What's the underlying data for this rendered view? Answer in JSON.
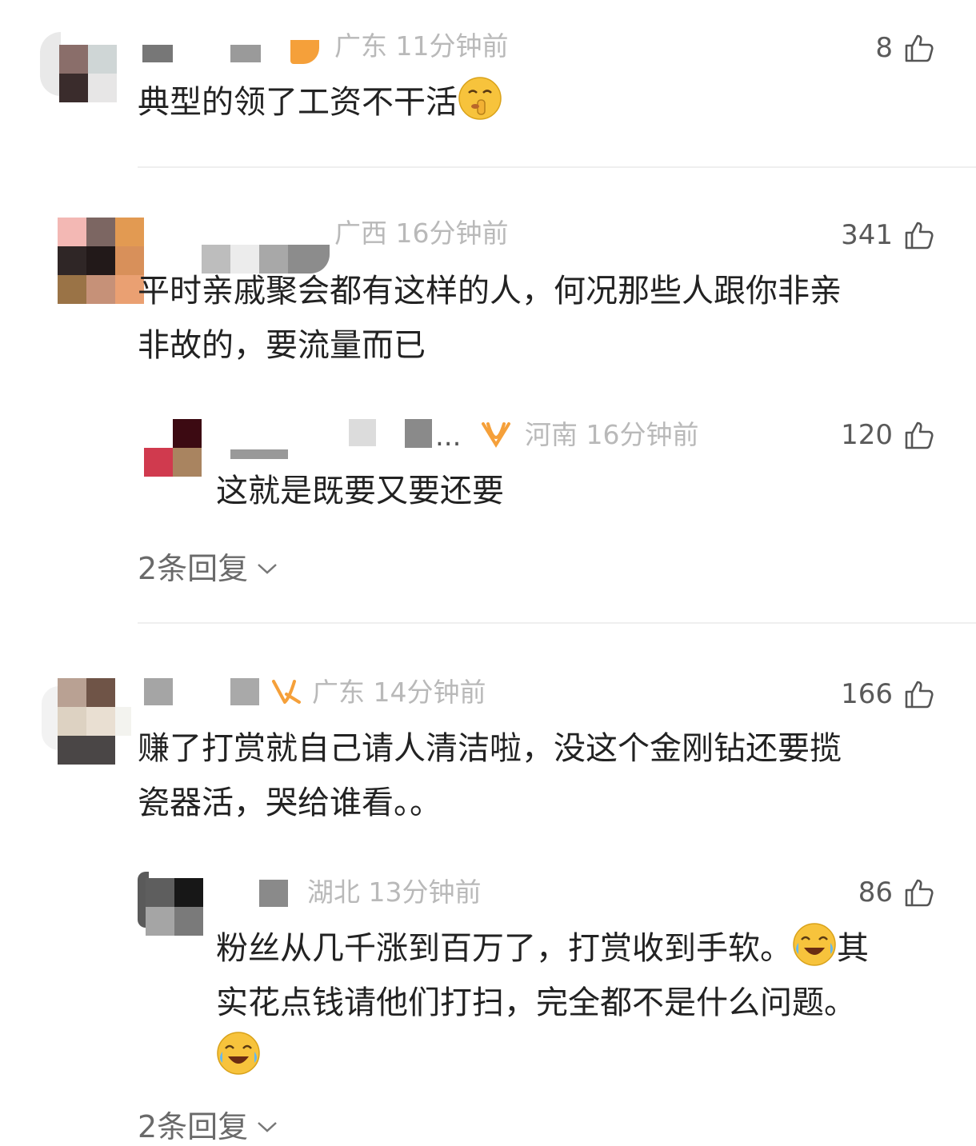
{
  "comments": [
    {
      "location_time": "广东 11分钟前",
      "likes": "8",
      "text": "典型的领了工资不干活",
      "emoji": "shush-emoji"
    },
    {
      "location_time": "广西 16分钟前",
      "likes": "341",
      "text_line1": "平时亲戚聚会都有这样的人，何况那些人跟你非亲",
      "text_line2": "非故的，要流量而已",
      "reply": {
        "ellipsis": "...",
        "location_time": "河南 16分钟前",
        "likes": "120",
        "text": "这就是既要又要还要"
      },
      "more_replies": "2条回复"
    },
    {
      "location_time": "广东 14分钟前",
      "likes": "166",
      "text_line1": "赚了打赏就自己请人清洁啦，没这个金刚钻还要揽",
      "text_line2": "瓷器活，哭给谁看。。",
      "reply": {
        "location_time": "湖北 13分钟前",
        "likes": "86",
        "text_line1a": "粉丝从几千涨到百万了，打赏收到手软。",
        "text_line1b": "其",
        "text_line2": "实花点钱请他们打扫，完全都不是什么问题。",
        "emoji": "crying-laughing-emoji"
      },
      "more_replies": "2条回复"
    }
  ],
  "colors": {
    "vip_badge": "#f5a03a",
    "meta_text": "#b9b9b9",
    "divider": "#efefef"
  }
}
